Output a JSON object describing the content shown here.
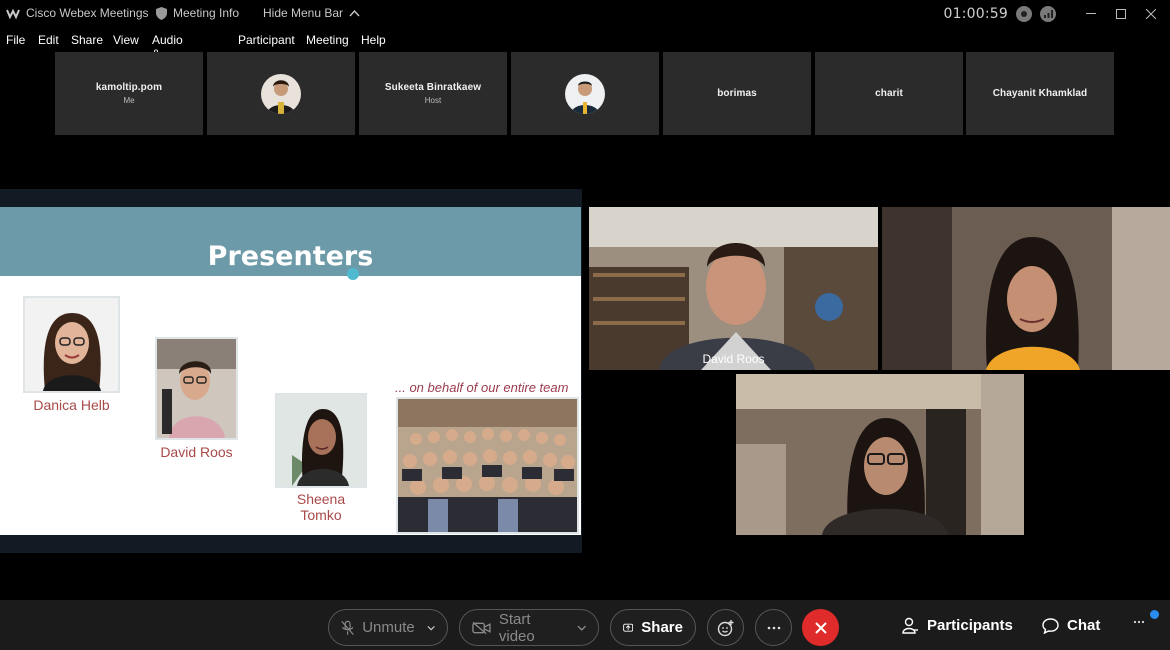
{
  "titlebar": {
    "app_name": "Cisco Webex Meetings",
    "meeting_info": "Meeting Info",
    "hide_menu": "Hide Menu Bar",
    "timer": "01:00:59"
  },
  "menu": [
    "File",
    "Edit",
    "Share",
    "View",
    "Audio & Video",
    "Participant",
    "Meeting",
    "Help"
  ],
  "participants": [
    {
      "name": "kamoltip.pom",
      "sub": "Me",
      "avatar": false
    },
    {
      "name": "",
      "sub": "",
      "avatar": true
    },
    {
      "name": "Sukeeta Binratkaew",
      "sub": "Host",
      "avatar": false
    },
    {
      "name": "",
      "sub": "",
      "avatar": true
    },
    {
      "name": "borimas",
      "sub": "",
      "avatar": false
    },
    {
      "name": "charit",
      "sub": "",
      "avatar": false
    },
    {
      "name": "Chayanit Khamklad",
      "sub": "",
      "avatar": false
    }
  ],
  "slide": {
    "title": "Presenters",
    "presenters": [
      "Danica Helb",
      "David Roos",
      "Sheena Tomko"
    ],
    "team_label": "... on behalf of our entire team"
  },
  "videos": {
    "active_name": "David Roos"
  },
  "controls": {
    "unmute": "Unmute",
    "start_video": "Start video",
    "share": "Share",
    "participants": "Participants",
    "chat": "Chat"
  },
  "colors": {
    "active_speaker": "#2aa9e0",
    "end_call": "#e02b2b",
    "slide_header": "#6d9aa8",
    "presenter_name": "#a94a4a"
  }
}
